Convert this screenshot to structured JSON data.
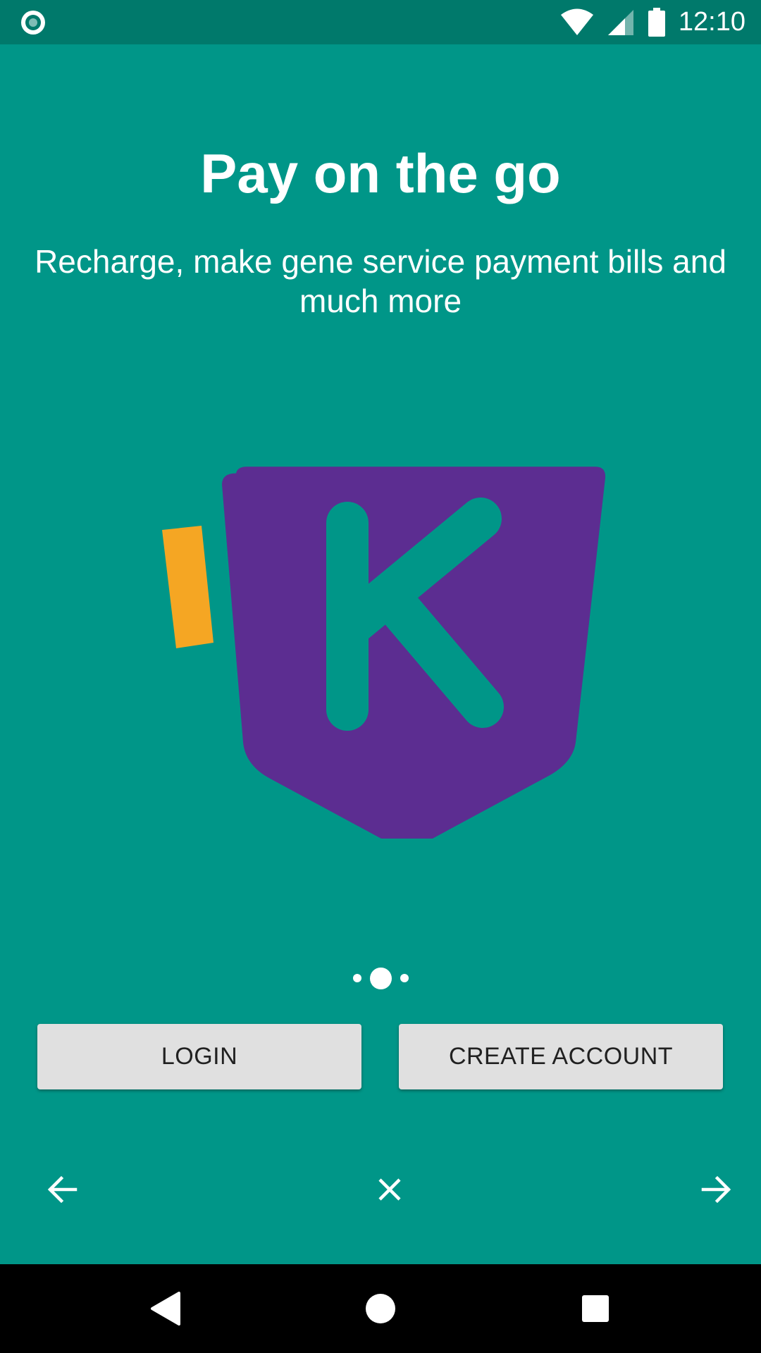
{
  "status_bar": {
    "time": "12:10",
    "icons": [
      "recording-dot-icon",
      "wifi-icon",
      "cell-signal-icon",
      "battery-icon"
    ]
  },
  "intro": {
    "title": "Pay on the go",
    "subtitle": "Recharge, make gene service payment bills and much more",
    "page_indicator": {
      "count": 3,
      "active_index": 1
    }
  },
  "logo": {
    "letter": "K",
    "colors": {
      "shield": "#5C2D91",
      "accent_bar": "#F5A623",
      "letter": "#009688"
    }
  },
  "buttons": {
    "login": "LOGIN",
    "create_account": "CREATE ACCOUNT"
  },
  "intro_nav": {
    "icons": [
      "arrow-left-icon",
      "close-icon",
      "arrow-right-icon"
    ]
  },
  "system_nav": {
    "icons": [
      "back-triangle-icon",
      "home-circle-icon",
      "recents-square-icon"
    ]
  },
  "colors": {
    "background": "#009688",
    "status_bar": "#00796B",
    "button_bg": "#E0E0E0",
    "button_text": "#212121"
  }
}
